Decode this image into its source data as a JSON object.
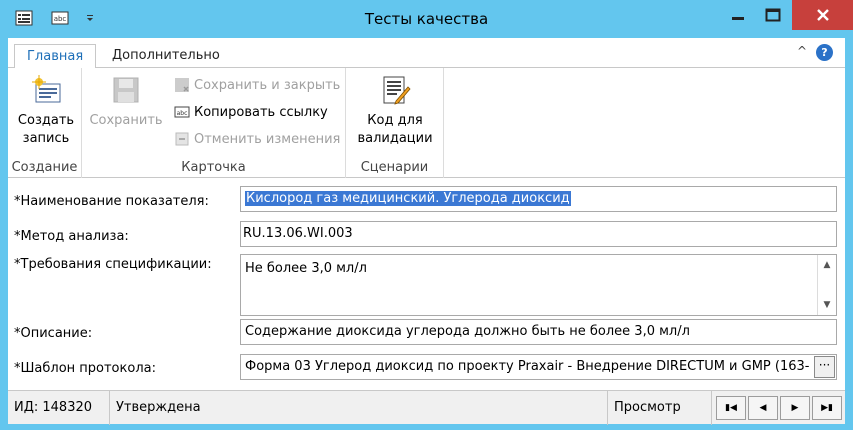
{
  "window": {
    "title": "Тесты качества",
    "accent": "#63c6ee",
    "close_color": "#c7403c"
  },
  "quick_access": {
    "icons": [
      "form-icon",
      "abc-icon",
      "dropdown-arrow-icon"
    ]
  },
  "tabs": [
    {
      "label": "Главная",
      "active": true
    },
    {
      "label": "Дополнительно",
      "active": false
    }
  ],
  "ribbon": {
    "create": {
      "label_line1": "Создать",
      "label_line2": "запись",
      "group": "Создание"
    },
    "save": {
      "label": "Сохранить"
    },
    "save_close": {
      "label": "Сохранить и закрыть"
    },
    "copy_link": {
      "label": "Копировать ссылку"
    },
    "cancel_changes": {
      "label": "Отменить изменения"
    },
    "card_group": "Карточка",
    "validation_code": {
      "label_line1": "Код для",
      "label_line2": "валидации",
      "group": "Сценарии"
    }
  },
  "form": {
    "indicator": {
      "label": "*Наименование показателя:",
      "value": "Кислород газ медицинский. Углерода диоксид"
    },
    "method": {
      "label": "*Метод анализа:",
      "value": "RU.13.06.WI.003"
    },
    "requirements": {
      "label": "*Требования спецификации:",
      "value": "Не более 3,0 мл/л"
    },
    "description": {
      "label": "*Описание:",
      "value": "Содержание диоксида углерода должно быть не более 3,0 мл/л"
    },
    "template": {
      "label": "*Шаблон протокола:",
      "value": "Форма 03 Углерод диоксид по проекту Praxair - Внедрение DIRECTUM и GMP (163-",
      "button": "···"
    }
  },
  "status": {
    "id": "ИД: 148320",
    "state": "Утверждена",
    "mode": "Просмотр"
  }
}
